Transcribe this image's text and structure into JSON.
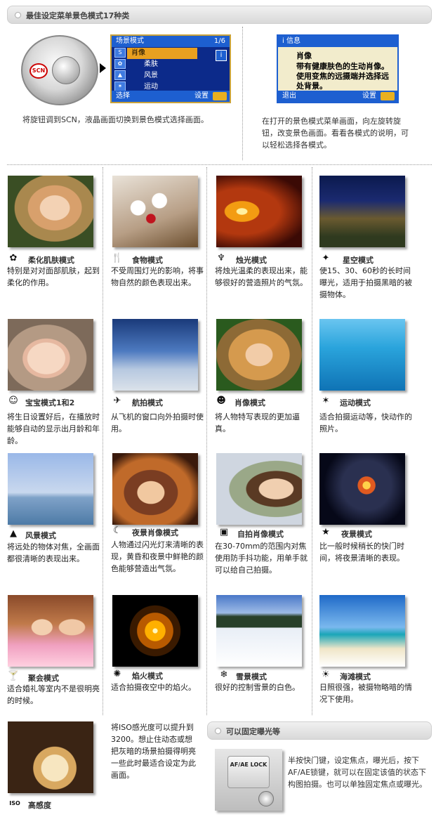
{
  "header_top": {
    "title": "最佳设定菜单景色模式17种类"
  },
  "header_bottom": {
    "title": "可以固定曝光等"
  },
  "top_left": {
    "dial_label": "SCN",
    "lcd": {
      "header": "场景模式",
      "page": "1/6",
      "items": [
        "肖像",
        "柔肤",
        "风景",
        "运动"
      ],
      "footer_left": "选择",
      "footer_right": "设置",
      "side_icon": "i",
      "menu_icon": "MENU"
    },
    "description": "将旋钮调到SCN，液晶画面切换到景色模式选择画面。"
  },
  "top_right": {
    "lcd": {
      "header": "i 信息",
      "title": "肖像",
      "body": "带有健康肤色的生动肖像。使用变焦的远摄端并选择远处背景。",
      "footer_left": "退出",
      "footer_right": "设置",
      "menu_icon": "MENU"
    },
    "description": "在打开的景色模式菜单画面，向左旋转旋钮，改变景色画面。看看各模式的说明，可以轻松选择各模式。"
  },
  "modes": [
    {
      "name": "柔化肌肤模式",
      "icon": "soft-skin-icon",
      "glyph": "✿",
      "desc": "特别是对对面部肌肤，起到柔化的作用。"
    },
    {
      "name": "食物模式",
      "icon": "food-icon",
      "glyph": "🍴",
      "desc": "不受周围灯光的影响，将事物自然的颜色表现出来。"
    },
    {
      "name": "烛光模式",
      "icon": "candle-icon",
      "glyph": "♆",
      "desc": "将烛光温柔的表现出来，能够很好的营造照片的气氛。"
    },
    {
      "name": "星空模式",
      "icon": "starry-sky-icon",
      "glyph": "✦",
      "desc": "使15、30、60秒的长时间曝光，适用于拍摄黑暗的被摄物体。"
    },
    {
      "name": "宝宝模式1和2",
      "icon": "baby-icon",
      "glyph": "☺",
      "desc": "将生日设置好后，在播放时能够自动的显示出月龄和年龄。"
    },
    {
      "name": "航拍模式",
      "icon": "aerial-icon",
      "glyph": "✈",
      "desc": "从飞机的窗口向外拍摄时使用。"
    },
    {
      "name": "肖像模式",
      "icon": "portrait-icon",
      "glyph": "☻",
      "desc": "将人物特写表现的更加逼真。"
    },
    {
      "name": "运动模式",
      "icon": "sports-icon",
      "glyph": "✶",
      "desc": "适合拍摄运动等，快动作的照片。"
    },
    {
      "name": "风景模式",
      "icon": "landscape-icon",
      "glyph": "▲",
      "desc": "将远处的物体对焦，全画面都很清晰的表现出来。"
    },
    {
      "name": "夜景肖像模式",
      "icon": "night-portrait-icon",
      "glyph": "☾",
      "desc": "人物通过闪光灯来清晰的表现，黄昏和夜景中鲜艳的颜色能够营造出气氛。"
    },
    {
      "name": "自拍肖像模式",
      "icon": "self-portrait-icon",
      "glyph": "▣",
      "desc": "在30-70mm的范围内对焦使用防手抖功能，用单手就可以给自己拍摄。"
    },
    {
      "name": "夜景模式",
      "icon": "night-scene-icon",
      "glyph": "★",
      "desc": "比一般时候稍长的快门时间，将夜景清晰的表现。"
    },
    {
      "name": "聚会模式",
      "icon": "party-icon",
      "glyph": "🍸",
      "desc": "适合婚礼等室内不是很明亮的时候。"
    },
    {
      "name": "焰火模式",
      "icon": "fireworks-icon",
      "glyph": "✺",
      "desc": "适合拍摄夜空中的焰火。"
    },
    {
      "name": "雪景模式",
      "icon": "snow-icon",
      "glyph": "❄",
      "desc": "很好的控制雪景的白色。"
    },
    {
      "name": "海滩模式",
      "icon": "beach-icon",
      "glyph": "☀",
      "desc": "日照很强，被摄物略暗的情况下使用。"
    },
    {
      "name": "高感度",
      "icon": "high-sensitivity-icon",
      "glyph": "ISO",
      "desc": "将ISO感光度可以提升到3200。想止住动态或想把灰暗的场景拍摄得明亮一些此时最适合设定为此画面。"
    }
  ],
  "exposure_lock": {
    "button_label": "AF/AE LOCK",
    "description": "半按快门键，设定焦点，曝光后，按下AF/AE锁键，就可以在固定该值的状态下构图拍摄。也可以单独固定焦点或曝光。"
  }
}
